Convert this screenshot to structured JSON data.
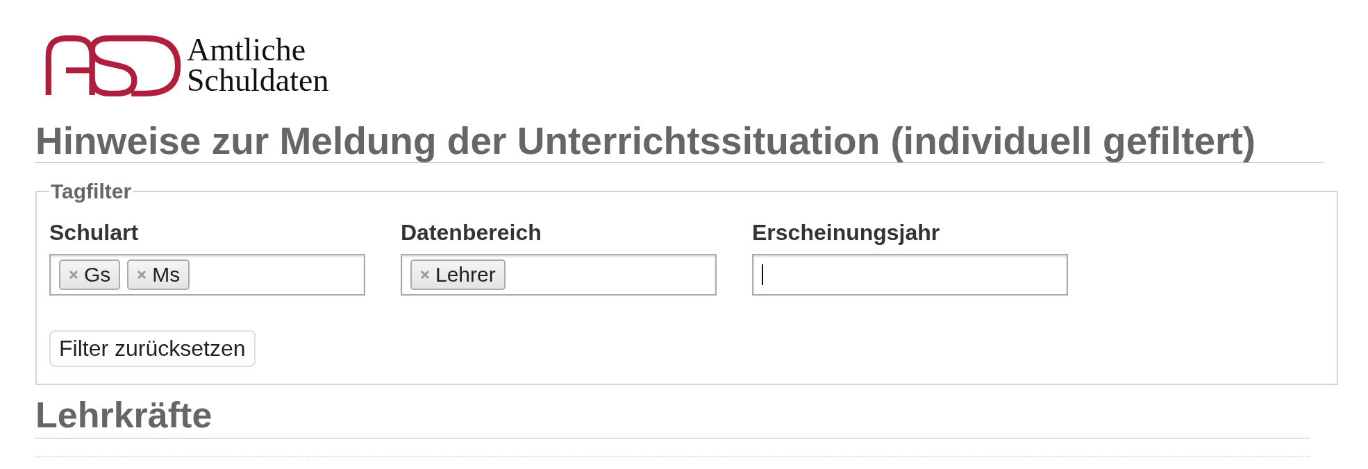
{
  "logo": {
    "lines": [
      "Amtliche",
      "Schuldaten"
    ]
  },
  "title": "Hinweise zur Meldung der Unterrichtssituation (individuell gefiltert)",
  "tagfilter": {
    "legend": "Tagfilter",
    "fields": [
      {
        "label": "Schulart",
        "tags": [
          "Gs",
          "Ms"
        ],
        "focused": false
      },
      {
        "label": "Datenbereich",
        "tags": [
          "Lehrer"
        ],
        "focused": false
      },
      {
        "label": "Erscheinungsjahr",
        "focused": true
      }
    ],
    "reset_button": "Filter zurücksetzen"
  },
  "section": {
    "title": "Lehrkräfte"
  }
}
